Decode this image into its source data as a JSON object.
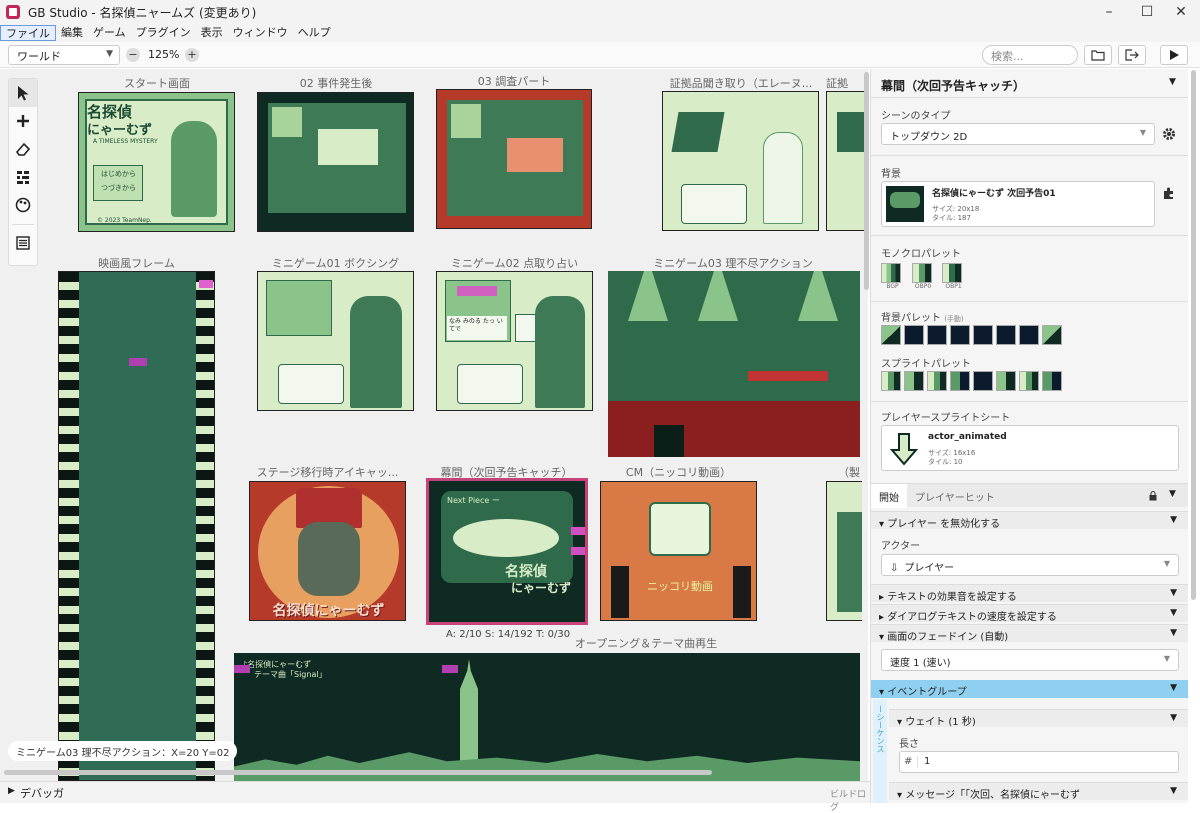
{
  "window": {
    "title": "GB Studio - 名探偵ニャームズ (変更あり)"
  },
  "menu": [
    "ファイル",
    "編集",
    "ゲーム",
    "プラグイン",
    "表示",
    "ウィンドウ",
    "ヘルプ"
  ],
  "toolbar": {
    "view_select": "ワールド",
    "zoom": "125%",
    "search_placeholder": "検索..."
  },
  "scenes": {
    "s1": "スタート画面",
    "s2": "02 事件発生後",
    "s3": "03 調査パート",
    "s4": "証拠品聞き取り（エレーヌ...",
    "s5": "証拠",
    "s6": "映画風フレーム",
    "s7": "ミニゲーム01 ボクシング",
    "s8": "ミニゲーム02 点取り占い",
    "s9": "ミニゲーム03 理不尽アクション",
    "s10": "ステージ移行時アイキャッ...",
    "s11": "幕間（次回予告キャッチ）",
    "s12": "CM（ニッコリ動画）",
    "s13": "（製",
    "s14": "オープニング＆テーマ曲再生"
  },
  "art": {
    "title_logo_1": "名探偵",
    "title_logo_2": "にゃーむず",
    "title_sub": "A TIMELESS MYSTERY",
    "title_start": "はじめから",
    "title_continue": "つづきから",
    "title_credit": "© 2023 TeamNep.",
    "next_piece": "Next Piece ー",
    "eyecatch_logo": "名探偵にゃーむず",
    "cm_text": "ニッコリ動画",
    "opening_line1": "♪名探偵にゃーむず",
    "opening_line2": "テーマ曲「Signal」",
    "fortune_text": "なみ みのる たっ いてで"
  },
  "status": {
    "coord": "ミニゲーム03 理不尽アクション：X=20 Y=02",
    "selection_stats": "A: 2/10    S: 14/192    T: 0/30"
  },
  "debug": {
    "label": "デバッガ",
    "build_log": "ビルドログ"
  },
  "sidebar": {
    "scene_name": "幕間（次回予告キャッチ）",
    "scene_type_label": "シーンのタイプ",
    "scene_type": "トップダウン 2D",
    "background_label": "背景",
    "background_name": "名探偵にゃーむず 次回予告01",
    "background_size": "サイズ: 20x18",
    "background_tiles": "タイル: 187",
    "mono_palette_label": "モノクロパレット",
    "mono_palettes": [
      "BGP",
      "OBP0",
      "OBP1"
    ],
    "bg_palette_label": "背景パレット",
    "bg_palette_note": "(手動)",
    "sprite_palette_label": "スプライトパレット",
    "player_sprite_label": "プレイヤースプライトシート",
    "player_sprite_name": "actor_animated",
    "player_sprite_size": "サイズ: 16x16",
    "player_sprite_tiles": "タイル: 10",
    "tab_start": "開始",
    "tab_hit": "プレイヤーヒット",
    "ev_disable_player": "プレイヤー を無効化する",
    "actor_label": "アクター",
    "actor_value": "プレイヤー",
    "ev_text_sound": "テキストの効果音を設定する",
    "ev_dialog_speed": "ダイアログテキストの速度を設定する",
    "ev_fade_in": "画面のフェードイン (自動)",
    "fade_speed": "速度 1 (速い)",
    "ev_group": "イベントグループ",
    "ev_wait": "ウェイト (1 秒)",
    "length_label": "長さ",
    "length_value": "1",
    "ev_message": "メッセージ「「次回、名探偵にゃーむず",
    "side_text": "ーシーケンス"
  },
  "colors": {
    "accent": "#8fd0f0",
    "gb_dark": "#0f2a23",
    "gb_mid": "#2f6b4a",
    "gb_light": "#8bc48a",
    "gb_pale": "#d7ecc7",
    "select": "#c8427a"
  }
}
